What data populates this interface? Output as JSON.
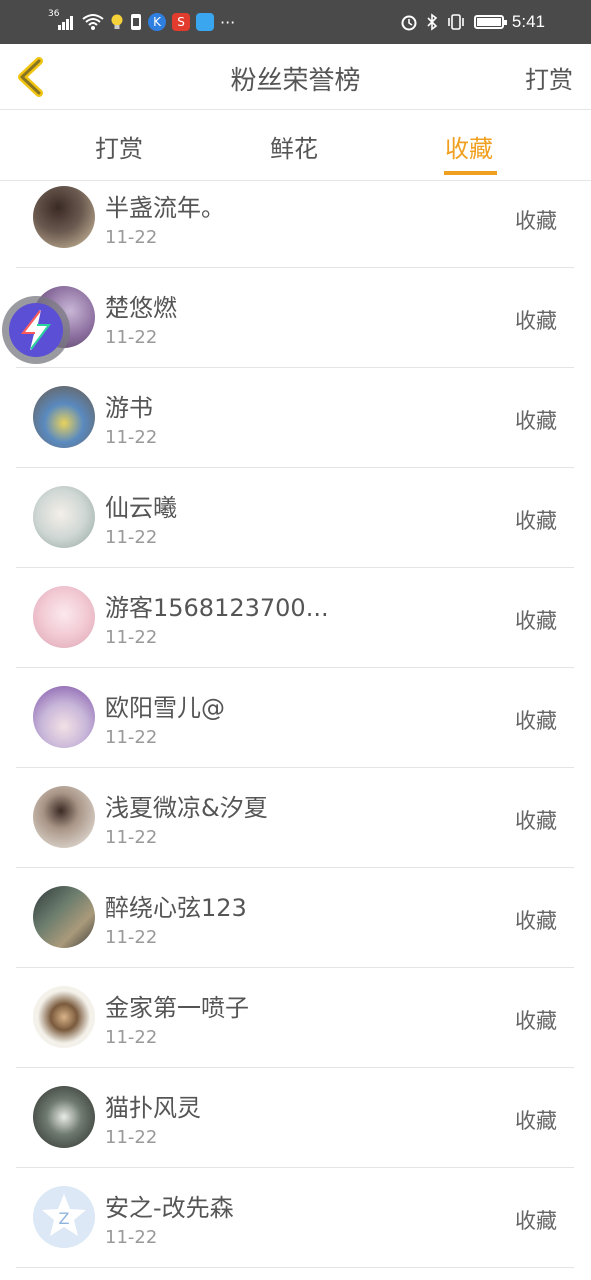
{
  "status_bar": {
    "network": "36",
    "time": "5:41",
    "more": "···",
    "icons": [
      "signal-icon",
      "wifi-icon",
      "bulb-icon",
      "sim-icon",
      "k-app-icon",
      "s-app-icon",
      "blue-app-icon",
      "alarm-icon",
      "bluetooth-icon",
      "vibrate-icon",
      "battery-icon"
    ]
  },
  "header": {
    "title": "粉丝荣誉榜",
    "right_action": "打赏",
    "back_icon": "chevron-left-icon"
  },
  "tabs": [
    {
      "label": "打赏",
      "active": false
    },
    {
      "label": "鲜花",
      "active": false
    },
    {
      "label": "收藏",
      "active": true
    }
  ],
  "accent_color": "#f0a020",
  "fans": [
    {
      "name": "半盏流年。",
      "date": "11-22",
      "action": "收藏"
    },
    {
      "name": "楚悠燃",
      "date": "11-22",
      "action": "收藏"
    },
    {
      "name": "游书",
      "date": "11-22",
      "action": "收藏"
    },
    {
      "name": "仙云曦",
      "date": "11-22",
      "action": "收藏"
    },
    {
      "name": "游客1568123700...",
      "date": "11-22",
      "action": "收藏"
    },
    {
      "name": "欧阳雪儿@",
      "date": "11-22",
      "action": "收藏"
    },
    {
      "name": "浅夏微凉&汐夏",
      "date": "11-22",
      "action": "收藏"
    },
    {
      "name": "醉绕心弦123",
      "date": "11-22",
      "action": "收藏"
    },
    {
      "name": "金家第一喷子",
      "date": "11-22",
      "action": "收藏"
    },
    {
      "name": "猫扑风灵",
      "date": "11-22",
      "action": "收藏"
    },
    {
      "name": "安之-改先森",
      "date": "11-22",
      "action": "收藏"
    }
  ],
  "floating_button": {
    "icon": "lightning-icon"
  }
}
